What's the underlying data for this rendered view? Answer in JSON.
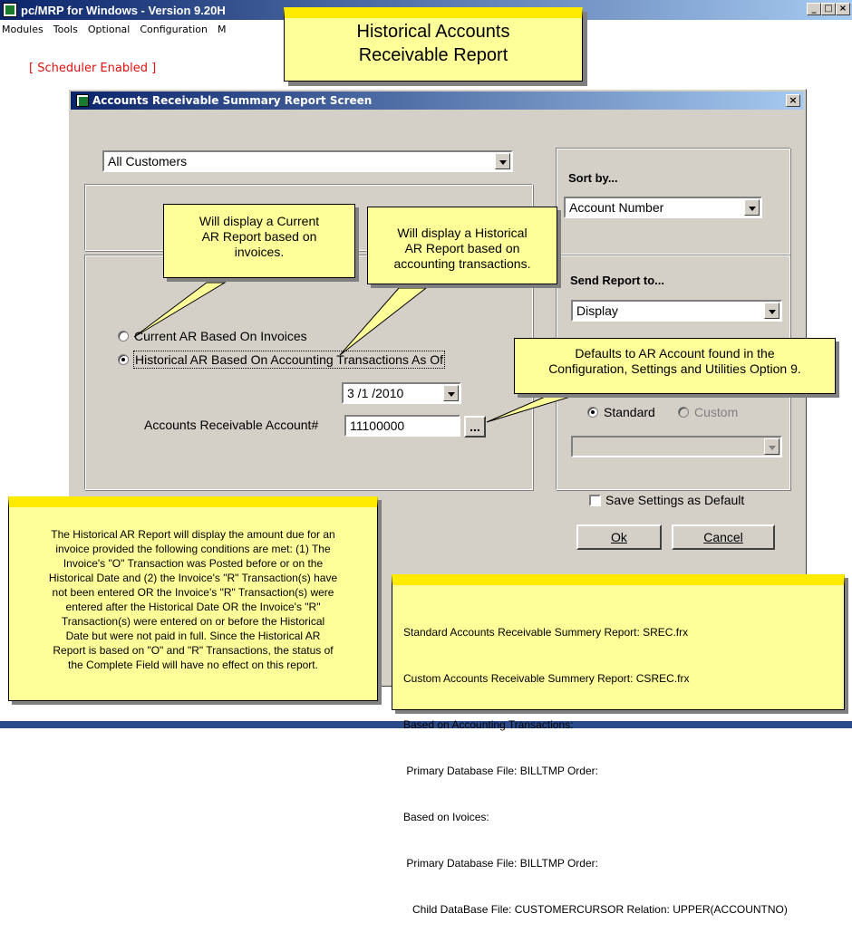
{
  "app": {
    "title": "pc/MRP for Windows - Version 9.20H",
    "menu": [
      "Modules",
      "Tools",
      "Optional",
      "Configuration",
      "M"
    ],
    "scheduler": "[ Scheduler Enabled ]"
  },
  "banner": {
    "line1": "Historical Accounts",
    "line2": "Receivable Report"
  },
  "dialog": {
    "title": "Accounts Receivable Summary Report Screen",
    "customer_filter": "All Customers",
    "radio_current": "Current AR Based On Invoices",
    "radio_historical": "Historical AR Based On Accounting Transactions As Of",
    "date": "3 /1 /2010",
    "ar_account_label": "Accounts Receivable Account#",
    "ar_account": "11100000",
    "browse": "...",
    "sort_label": "Sort by...",
    "sort_value": "Account Number",
    "send_label": "Send Report to...",
    "send_value": "Display",
    "standard": "Standard",
    "custom": "Custom",
    "save_default": "Save Settings as Default",
    "ok": "Ok",
    "cancel": "Cancel"
  },
  "callouts": {
    "current": [
      "Will display a Current",
      "AR Report based on",
      "invoices."
    ],
    "historical": [
      "Will display a Historical",
      "AR Report based on",
      "accounting transactions."
    ],
    "defaults": [
      "Defaults to AR Account found in the",
      "Configuration, Settings and Utilities Option 9."
    ]
  },
  "note_left": [
    "The Historical AR Report will display the amount due for an",
    "invoice provided the following conditions are met: (1) The",
    "Invoice's \"O\"  Transaction was Posted before or on the",
    "Historical Date and (2) the Invoice's \"R\" Transaction(s) have",
    "not been entered OR the Invoice's \"R\" Transaction(s) were",
    "entered after the Historical Date OR the Invoice's \"R\"",
    "Transaction(s) were entered on or before the Historical",
    "Date but were not paid in full.  Since the Historical AR",
    "Report is based on \"O\" and \"R\" Transactions, the status of",
    "the Complete Field will have no effect on this report."
  ],
  "note_right": [
    "Standard Accounts Receivable Summery Report: SREC.frx",
    "Custom Accounts Receivable Summery Report: CSREC.frx",
    "Based on Accounting Transactions:",
    " Primary Database File: BILLTMP Order:",
    "Based on Ivoices:",
    " Primary Database File: BILLTMP Order:",
    "   Child DataBase File: CUSTOMERCURSOR Relation: UPPER(ACCOUNTNO)"
  ]
}
